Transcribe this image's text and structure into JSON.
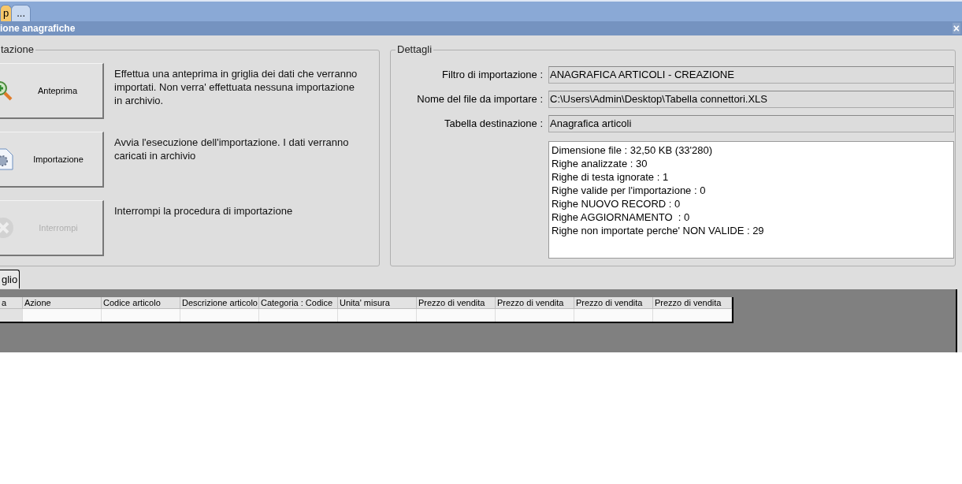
{
  "tabs": [
    {
      "label": "p",
      "selected": true
    },
    {
      "label": "...",
      "selected": false
    }
  ],
  "window": {
    "title": "ione anagrafiche",
    "close": "×"
  },
  "actions_group": {
    "legend": "tazione",
    "actions": [
      {
        "kind": "preview",
        "label": "Anteprima",
        "disabled": false,
        "description": "Effettua una anteprima in griglia dei dati che verranno importati. Non verra' effettuata nessuna importazione in archivio."
      },
      {
        "kind": "import",
        "label": "Importazione",
        "disabled": false,
        "description": "Avvia l'esecuzione dell'importazione. I dati verranno caricati in archivio"
      },
      {
        "kind": "stop",
        "label": "Interrompi",
        "disabled": true,
        "description": "Interrompi la procedura di importazione"
      }
    ]
  },
  "details": {
    "legend": "Dettagli",
    "fields": [
      {
        "label": "Filtro di importazione :",
        "value": "ANAGRAFICA ARTICOLI - CREAZIONE"
      },
      {
        "label": "Nome del file da importare :",
        "value": "C:\\Users\\Admin\\Desktop\\Tabella connettori.XLS"
      },
      {
        "label": "Tabella destinazione :",
        "value": "Anagrafica articoli"
      }
    ],
    "summary": [
      "Dimensione file : 32,50 KB (33'280)",
      "Righe analizzate : 30",
      "Righe di testa ignorate : 1",
      "Righe valide per l'importazione : 0",
      "Righe NUOVO RECORD : 0",
      "Righe AGGIORNAMENTO  : 0",
      "Righe non importate perche' NON VALIDE : 29"
    ]
  },
  "grid_tab": {
    "label": "glio",
    "selected": true
  },
  "table": {
    "columns": [
      "a",
      "Azione",
      "Codice articolo",
      "Descrizione articolo",
      "Categoria : Codice",
      "Unita' misura",
      "Prezzo di vendita",
      "Prezzo di vendita",
      "Prezzo di vendita",
      "Prezzo di vendita"
    ]
  }
}
